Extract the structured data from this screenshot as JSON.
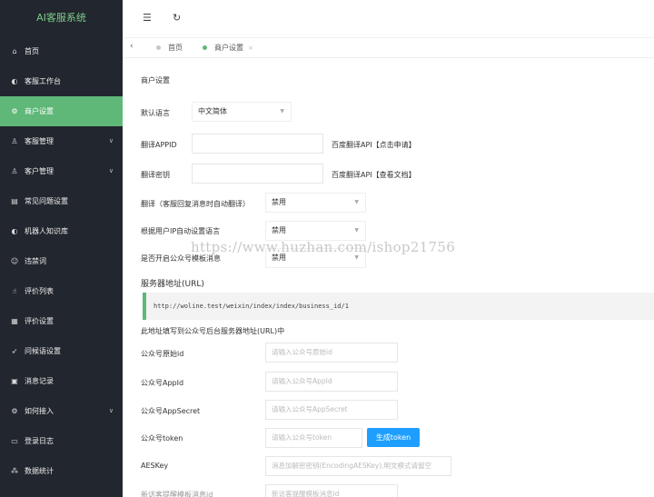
{
  "app": {
    "title": "AI客服系统"
  },
  "sidebar": {
    "items": [
      {
        "icon": "home-icon",
        "glyph": "⌂",
        "label": "首页",
        "has_children": false
      },
      {
        "icon": "workbench-icon",
        "glyph": "◐",
        "label": "客服工作台",
        "has_children": false
      },
      {
        "icon": "gear-icon",
        "glyph": "⚙",
        "label": "商户设置",
        "has_children": false,
        "active": true
      },
      {
        "icon": "user-icon",
        "glyph": "♙",
        "label": "客服管理",
        "has_children": true
      },
      {
        "icon": "users-icon",
        "glyph": "♙",
        "label": "客户管理",
        "has_children": true
      },
      {
        "icon": "faq-icon",
        "glyph": "▤",
        "label": "常见问题设置",
        "has_children": false
      },
      {
        "icon": "robot-icon",
        "glyph": "◐",
        "label": "机器人知识库",
        "has_children": false
      },
      {
        "icon": "banned-words-icon",
        "glyph": "☺",
        "label": "违禁词",
        "has_children": false
      },
      {
        "icon": "thumbs-up-icon",
        "glyph": "☝",
        "label": "评价列表",
        "has_children": false
      },
      {
        "icon": "calendar-icon",
        "glyph": "▦",
        "label": "评价设置",
        "has_children": false
      },
      {
        "icon": "send-icon",
        "glyph": "➶",
        "label": "问候语设置",
        "has_children": false
      },
      {
        "icon": "message-icon",
        "glyph": "▣",
        "label": "消息记录",
        "has_children": false
      },
      {
        "icon": "link-icon",
        "glyph": "⚙",
        "label": "如何接入",
        "has_children": true
      },
      {
        "icon": "log-icon",
        "glyph": "▭",
        "label": "登录日志",
        "has_children": false
      },
      {
        "icon": "stats-icon",
        "glyph": "⁂",
        "label": "数据统计",
        "has_children": false
      }
    ]
  },
  "topbar": {
    "menu_toggle_glyph": "☰",
    "refresh_glyph": "↻"
  },
  "tabs": {
    "back_glyph": "‹",
    "items": [
      {
        "label": "首页",
        "dot_color": "#c8c8c8",
        "closable": false
      },
      {
        "label": "商户设置",
        "dot_color": "#5fb878",
        "closable": true
      }
    ],
    "close_glyph": "×"
  },
  "form": {
    "section_title": "商户设置",
    "default_language": {
      "label": "默认语言",
      "value": "中文简体"
    },
    "translate_appid": {
      "label": "翻译APPID",
      "value": "",
      "link_text": "百度翻译API【点击申请】"
    },
    "translate_secret": {
      "label": "翻译密钥",
      "value": "",
      "link_text": "百度翻译API【查看文档】"
    },
    "auto_translate": {
      "label": "翻译（客服回复消息时自动翻译）",
      "value": "禁用"
    },
    "ip_language": {
      "label": "根据用户IP自动设置语言",
      "value": "禁用"
    },
    "template_message": {
      "label": "是否开启公众号模板消息",
      "value": "禁用"
    },
    "server_url": {
      "label": "服务器地址(URL)",
      "value": "http://woline.test/weixin/index/index/business_id/1",
      "hint": "此地址填写到公众号后台服务器地址(URL)中"
    },
    "original_id": {
      "label": "公众号原始id",
      "placeholder": "请输入公众号原始id"
    },
    "appid": {
      "label": "公众号AppId",
      "placeholder": "请输入公众号AppId"
    },
    "appsecret": {
      "label": "公众号AppSecret",
      "placeholder": "请输入公众号AppSecret"
    },
    "token": {
      "label": "公众号token",
      "placeholder": "请输入公众号token",
      "button_label": "生成token"
    },
    "aeskey": {
      "label": "AESKey",
      "placeholder": "消息加解密密钥(EncodingAESKey),明文模式请留空"
    },
    "template_id": {
      "label": "新访客提醒模板消息id",
      "placeholder": "新访客提醒模板消息id"
    }
  },
  "watermark": "https://www.huzhan.com/ishop21756",
  "colors": {
    "accent": "#5fb878",
    "sidebar_bg": "#22262e",
    "button": "#1e9fff",
    "logo": "#7ccf8a"
  }
}
